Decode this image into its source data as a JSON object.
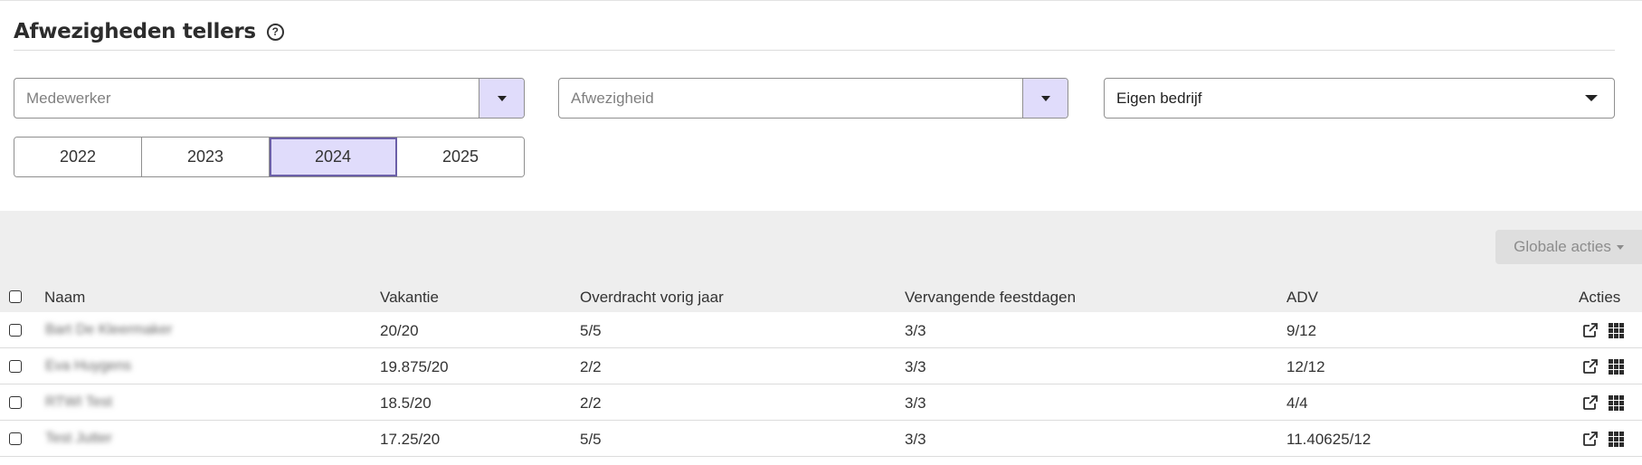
{
  "header": {
    "title": "Afwezigheden tellers"
  },
  "filters": {
    "employee_placeholder": "Medewerker",
    "absence_placeholder": "Afwezigheid",
    "company_value": "Eigen bedrijf"
  },
  "years": [
    {
      "label": "2022",
      "active": false
    },
    {
      "label": "2023",
      "active": false
    },
    {
      "label": "2024",
      "active": true
    },
    {
      "label": "2025",
      "active": false
    }
  ],
  "toolbar": {
    "global_actions_label": "Globale acties"
  },
  "table": {
    "columns": [
      "Naam",
      "Vakantie",
      "Overdracht vorig jaar",
      "Vervangende feestdagen",
      "ADV",
      "Acties"
    ],
    "rows": [
      {
        "name": "Bart De Kleermaker",
        "vakantie": "20/20",
        "overdracht": "5/5",
        "feestdagen": "3/3",
        "adv": "9/12"
      },
      {
        "name": "Eva Huygens",
        "vakantie": "19.875/20",
        "overdracht": "2/2",
        "feestdagen": "3/3",
        "adv": "12/12"
      },
      {
        "name": "RTWI Test",
        "vakantie": "18.5/20",
        "overdracht": "2/2",
        "feestdagen": "3/3",
        "adv": "4/4"
      },
      {
        "name": "Test Jutter",
        "vakantie": "17.25/20",
        "overdracht": "5/5",
        "feestdagen": "3/3",
        "adv": "11.40625/12"
      }
    ]
  },
  "colors": {
    "accent": "#e0dcfb",
    "accent_border": "#6b5fa8",
    "band": "#eeeeee"
  },
  "icons": [
    "help-icon",
    "chevron-down-icon",
    "external-link-icon",
    "grid-icon"
  ]
}
